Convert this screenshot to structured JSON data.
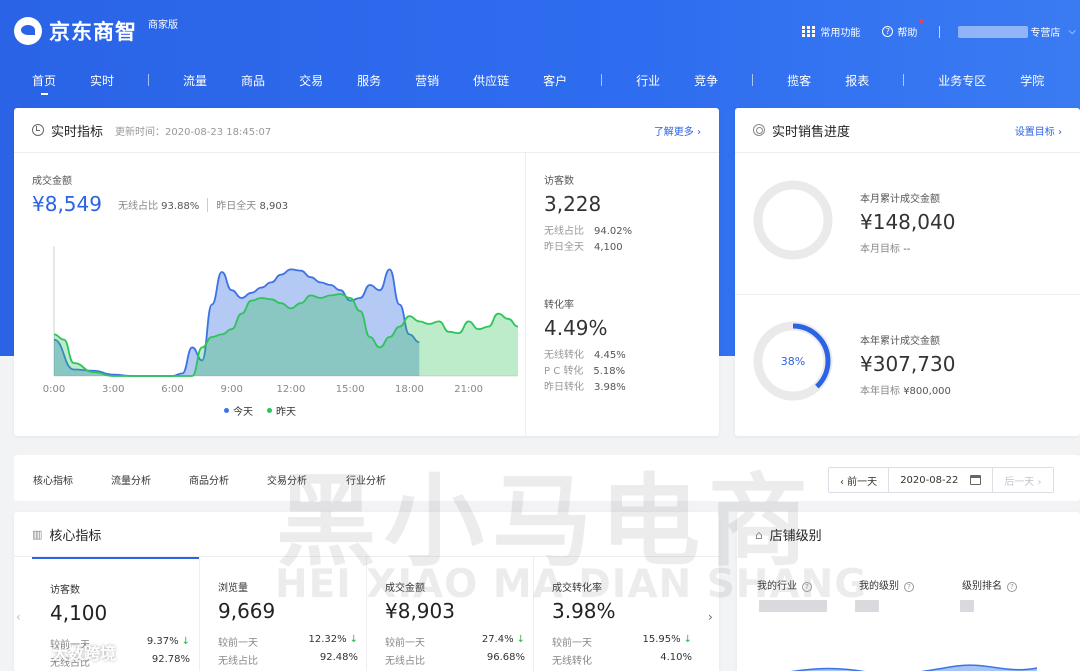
{
  "brand": {
    "name": "京东商智",
    "edition": "商家版"
  },
  "topbar": {
    "common_functions": "常用功能",
    "help": "帮助",
    "store_suffix": "专营店"
  },
  "nav": [
    {
      "label": "首页",
      "active": true
    },
    {
      "label": "实时"
    },
    {
      "sep": true
    },
    {
      "label": "流量"
    },
    {
      "label": "商品"
    },
    {
      "label": "交易"
    },
    {
      "label": "服务"
    },
    {
      "label": "营销"
    },
    {
      "label": "供应链"
    },
    {
      "label": "客户"
    },
    {
      "sep": true
    },
    {
      "label": "行业"
    },
    {
      "label": "竞争"
    },
    {
      "sep": true
    },
    {
      "label": "揽客"
    },
    {
      "label": "报表"
    },
    {
      "sep": true
    },
    {
      "label": "业务专区"
    },
    {
      "label": "学院"
    }
  ],
  "realtime": {
    "title": "实时指标",
    "updated": "更新时间：2020-08-23 18:45:07",
    "more": "了解更多 ›",
    "gmv_label": "成交金额",
    "gmv_value": "¥8,549",
    "wireless_share_label": "无线占比",
    "wireless_share_value": "93.88%",
    "yesterday_label": "昨日全天",
    "yesterday_value": "8,903",
    "visitors_label": "访客数",
    "visitors_value": "3,228",
    "visitors_wireless_label": "无线占比",
    "visitors_wireless_value": "94.02%",
    "visitors_yesterday_label": "昨日全天",
    "visitors_yesterday_value": "4,100",
    "cvr_label": "转化率",
    "cvr_value": "4.49%",
    "cvr_wireless_label": "无线转化",
    "cvr_wireless_value": "4.45%",
    "cvr_pc_label": "P C 转化",
    "cvr_pc_value": "5.18%",
    "cvr_yesterday_label": "昨日转化",
    "cvr_yesterday_value": "3.98%"
  },
  "chart_data": {
    "type": "area",
    "x_ticks": [
      "0:00",
      "3:00",
      "6:00",
      "9:00",
      "12:00",
      "15:00",
      "18:00",
      "21:00"
    ],
    "xlim": [
      0,
      23.5
    ],
    "ylim": [
      0,
      100
    ],
    "series": [
      {
        "name": "今天",
        "color": "#3d72e6",
        "x": [
          0,
          1,
          2,
          3,
          4,
          5,
          6,
          6.5,
          7,
          7.5,
          8,
          8.5,
          9,
          9.5,
          10,
          10.5,
          11,
          11.5,
          12,
          12.5,
          13,
          13.5,
          14,
          14.5,
          15,
          15.5,
          16,
          16.5,
          17,
          17.5,
          18,
          18.5
        ],
        "y": [
          28,
          5,
          4,
          1,
          0,
          0,
          0,
          2,
          22,
          12,
          55,
          80,
          66,
          60,
          64,
          68,
          72,
          78,
          82,
          81,
          76,
          72,
          70,
          66,
          58,
          60,
          70,
          66,
          82,
          55,
          32,
          26
        ]
      },
      {
        "name": "昨天",
        "color": "#2ec45a",
        "x": [
          0,
          0.5,
          1,
          2,
          3,
          4,
          5,
          6,
          7,
          7.5,
          8,
          8.5,
          9,
          9.5,
          10,
          10.5,
          11,
          11.5,
          12,
          12.5,
          13,
          13.5,
          14,
          14.5,
          15,
          15.5,
          16,
          16.5,
          17,
          17.5,
          18,
          18.5,
          19,
          19.5,
          20,
          20.5,
          21,
          21.5,
          22,
          22.5,
          23,
          23.5
        ],
        "y": [
          32,
          28,
          10,
          3,
          0,
          0,
          0,
          0,
          0,
          22,
          30,
          32,
          36,
          48,
          58,
          60,
          59,
          56,
          52,
          56,
          62,
          60,
          62,
          63,
          60,
          50,
          30,
          22,
          30,
          38,
          46,
          42,
          40,
          42,
          34,
          33,
          42,
          36,
          38,
          48,
          44,
          38
        ]
      }
    ],
    "legend": "bottom"
  },
  "sales_progress": {
    "title": "实时销售进度",
    "set_target": "设置目标 ›",
    "month_label": "本月累计成交金额",
    "month_value": "¥148,040",
    "month_target_label": "本月目标",
    "month_target_value": "--",
    "month_progress": 0,
    "year_label": "本年累计成交金额",
    "year_value": "¥307,730",
    "year_target_label": "本年目标",
    "year_target_value": "¥800,000",
    "year_pct": "38%",
    "year_progress": 0.38
  },
  "analysis_tabs": [
    "核心指标",
    "流量分析",
    "商品分析",
    "交易分析",
    "行业分析"
  ],
  "date_ctl": {
    "prev": "‹ 前一天",
    "date": "2020-08-22",
    "next": "后一天 ›"
  },
  "core": {
    "title": "核心指标",
    "metrics": [
      {
        "label": "访客数",
        "value": "4,100",
        "r1_label": "较前一天",
        "r1_value": "9.37%",
        "r2_label": "无线占比",
        "r2_value": "92.78%"
      },
      {
        "label": "浏览量",
        "value": "9,669",
        "r1_label": "较前一天",
        "r1_value": "12.32%",
        "r2_label": "无线占比",
        "r2_value": "92.48%"
      },
      {
        "label": "成交金额",
        "value": "¥8,903",
        "r1_label": "较前一天",
        "r1_value": "27.4%",
        "r2_label": "无线占比",
        "r2_value": "96.68%"
      },
      {
        "label": "成交转化率",
        "value": "3.98%",
        "r1_label": "较前一天",
        "r1_value": "15.95%",
        "r2_label": "无线转化",
        "r2_value": "4.10%"
      }
    ]
  },
  "shop_level": {
    "title": "店铺级别",
    "my_industry": "我的行业",
    "my_level": "我的级别",
    "rank": "级别排名"
  },
  "watermark": {
    "cn": "黑小马电商",
    "en": "HEI XIAO MA DIAN SHANG",
    "corner": "大数跨境"
  }
}
